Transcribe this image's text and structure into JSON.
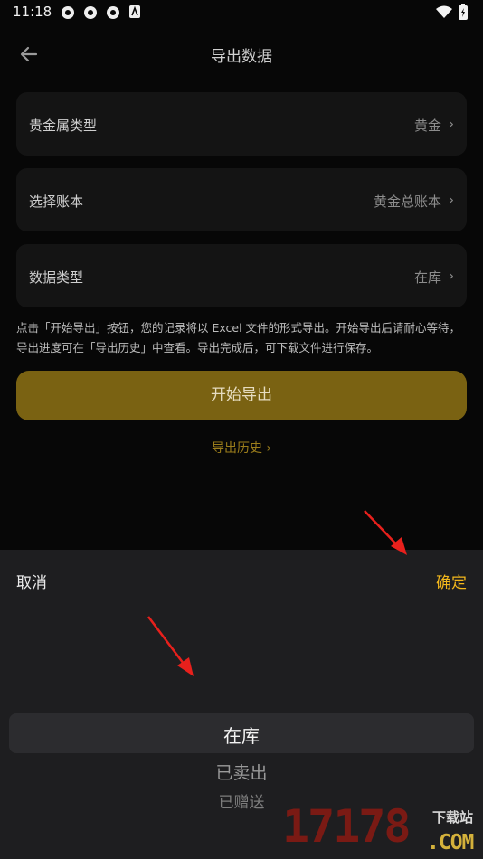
{
  "status_bar": {
    "time": "11:18"
  },
  "header": {
    "title": "导出数据"
  },
  "fields": [
    {
      "label": "贵金属类型",
      "value": "黄金"
    },
    {
      "label": "选择账本",
      "value": "黄金总账本"
    },
    {
      "label": "数据类型",
      "value": "在库"
    }
  ],
  "chevron": "›",
  "note": "点击「开始导出」按钮，您的记录将以 Excel 文件的形式导出。开始导出后请耐心等待，导出进度可在「导出历史」中查看。导出完成后，可下载文件进行保存。",
  "start_button": "开始导出",
  "history_link": "导出历史 ›",
  "sheet": {
    "cancel": "取消",
    "confirm": "确定",
    "options": [
      "在库",
      "已卖出",
      "已赠送"
    ],
    "selected_index": 0
  },
  "watermark": {
    "number": "17178",
    "download": "下载站",
    "domain": ".COM"
  },
  "colors": {
    "accent": "#f4b81c",
    "button": "#7a6212",
    "annotation_arrow": "#e8201c"
  }
}
